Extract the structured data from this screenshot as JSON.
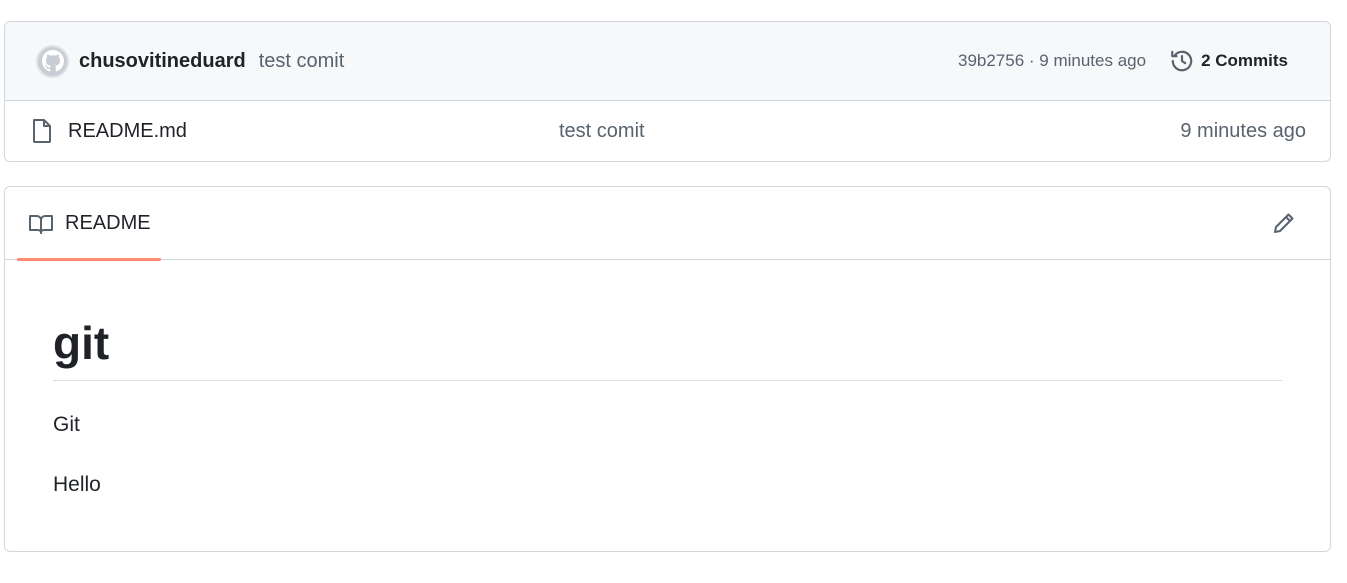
{
  "latest_commit": {
    "author": "chusovitineduard",
    "message": "test comit",
    "meta": "39b2756 · 9 minutes ago",
    "commits_label": "2 Commits"
  },
  "files": [
    {
      "name": "README.md",
      "commit_message": "test comit",
      "age": "9 minutes ago"
    }
  ],
  "readme": {
    "tab_label": "README",
    "heading": "git",
    "paragraphs": [
      "Git",
      "Hello"
    ]
  },
  "icons": {
    "history": "history-icon",
    "file": "file-icon",
    "book": "book-icon",
    "edit": "pencil-icon",
    "avatar": "github-mark-icon"
  },
  "colors": {
    "border": "#d0d7de",
    "header_bg": "#f6f8fa",
    "muted_text": "#59636e",
    "active_tab_underline": "#fd8c73"
  }
}
